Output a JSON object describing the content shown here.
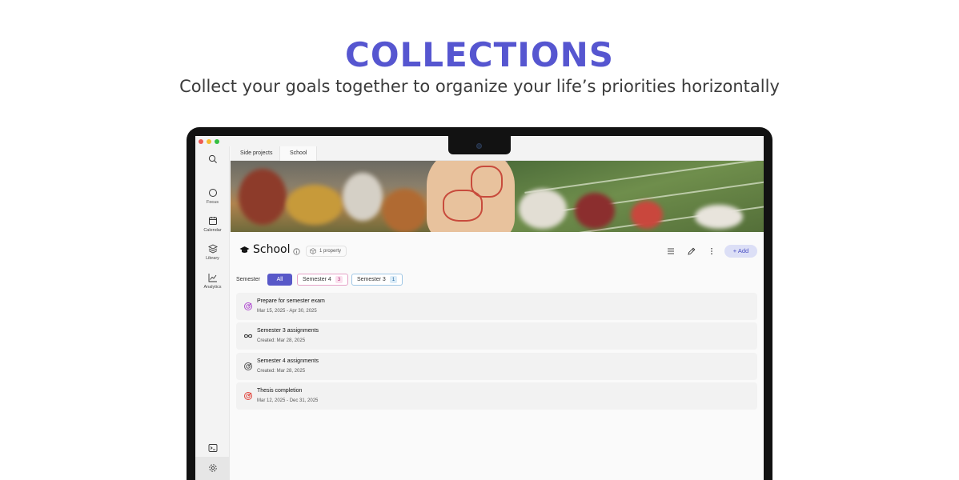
{
  "hero": {
    "title": "COLLECTIONS",
    "subtitle": "Collect your goals together to organize your life’s priorities horizontally"
  },
  "sidebar": {
    "items": [
      {
        "label": "",
        "icon": "search-icon"
      },
      {
        "label": "Focus",
        "icon": "circle-icon"
      },
      {
        "label": "Calendar",
        "icon": "calendar-icon"
      },
      {
        "label": "Library",
        "icon": "layers-icon"
      },
      {
        "label": "Analytics",
        "icon": "chart-icon"
      }
    ],
    "bottom": [
      {
        "icon": "terminal-icon"
      },
      {
        "icon": "gear-icon"
      }
    ]
  },
  "tabs": [
    {
      "label": "Side projects",
      "active": false
    },
    {
      "label": "School",
      "active": true
    }
  ],
  "header": {
    "title": "School",
    "property_chip": "1 property",
    "add_label": "Add"
  },
  "filters": {
    "label": "Semester",
    "options": [
      {
        "label": "All",
        "selected": true
      },
      {
        "label": "Semester 4",
        "count": "3"
      },
      {
        "label": "Semester 3",
        "count": "1"
      }
    ]
  },
  "goals": [
    {
      "title": "Prepare for semester exam",
      "subtitle": "Mar 15, 2025 - Apr 30, 2025",
      "icon": "target-icon",
      "color": "#b04fd0"
    },
    {
      "title": "Semester 3 assignments",
      "subtitle": "Created: Mar 28, 2025",
      "icon": "infinity-icon",
      "color": "#333333"
    },
    {
      "title": "Semester 4 assignments",
      "subtitle": "Created: Mar 28, 2025",
      "icon": "target-icon",
      "color": "#555555"
    },
    {
      "title": "Thesis completion",
      "subtitle": "Mar 12, 2025 - Dec 31, 2025",
      "icon": "target-icon",
      "color": "#e0443c"
    }
  ],
  "colors": {
    "accent": "#5656d0",
    "add_button_bg": "#dcdff6"
  }
}
